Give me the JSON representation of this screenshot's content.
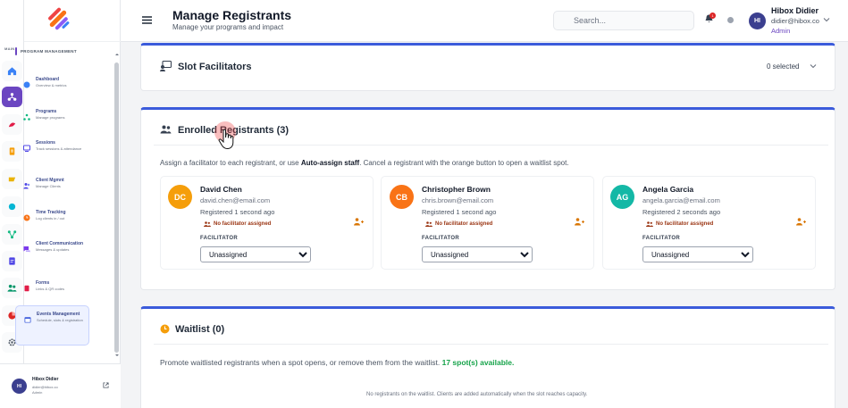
{
  "rail": {
    "section_label": "MAIN",
    "icons": [
      "home-icon",
      "programs-icon",
      "sessions-icon",
      "clipboard-icon",
      "coins-icon",
      "circle-icon",
      "network-icon",
      "document-icon",
      "users-icon",
      "chart-icon",
      "settings-icon"
    ]
  },
  "nav": {
    "section_label": "PROGRAM MANAGEMENT",
    "items": [
      {
        "title": "Dashboard",
        "desc": "Overview & metrics"
      },
      {
        "title": "Programs",
        "desc": "Manage programs"
      },
      {
        "title": "Sessions",
        "desc": "Track sessions & attendance"
      },
      {
        "title": "Client Mgmnt",
        "desc": "Manage Clients"
      },
      {
        "title": "Time Tracking",
        "desc": "Log clients in / out"
      },
      {
        "title": "Client Communication",
        "desc": "Messages & updates"
      },
      {
        "title": "Forms",
        "desc": "Links & QR codes"
      },
      {
        "title": "Events Management",
        "desc": "Schedule, slots & registration"
      }
    ],
    "user": {
      "initials": "HI",
      "name": "Hibox Didier",
      "email": "didier@hibox.co",
      "role": "Admin"
    }
  },
  "header": {
    "title": "Manage Registrants",
    "subtitle": "Manage your programs and impact",
    "search_placeholder": "Search...",
    "notification_count": "1",
    "user": {
      "initials": "HI",
      "name": "Hibox Didier",
      "email": "didier@hibox.co",
      "role": "Admin"
    }
  },
  "slot_facilitators": {
    "title": "Slot Facilitators",
    "selected": "0 selected"
  },
  "enrolled": {
    "title": "Enrolled Registrants (3)",
    "info_prefix": "Assign a facilitator to each registrant, or use ",
    "info_bold": "Auto-assign staff",
    "info_suffix": ". Cancel a registrant with the orange button to open a waitlist spot.",
    "facilitator_label": "FACILITATOR",
    "registrants": [
      {
        "initials": "DC",
        "color": "#f59e0b",
        "name": "David Chen",
        "email": "david.chen@email.com",
        "registered": "Registered 1 second ago",
        "status": "No facilitator assigned",
        "facilitator": "Unassigned"
      },
      {
        "initials": "CB",
        "color": "#f97316",
        "name": "Christopher Brown",
        "email": "chris.brown@email.com",
        "registered": "Registered 1 second ago",
        "status": "No facilitator assigned",
        "facilitator": "Unassigned"
      },
      {
        "initials": "AG",
        "color": "#14b8a6",
        "name": "Angela Garcia",
        "email": "angela.garcia@email.com",
        "registered": "Registered 2 seconds ago",
        "status": "No facilitator assigned",
        "facilitator": "Unassigned"
      }
    ]
  },
  "waitlist": {
    "title": "Waitlist (0)",
    "info_prefix": "Promote waitlisted registrants when a spot opens, or remove them from the waitlist. ",
    "info_highlight": "17 spot(s) available.",
    "empty_text": "No registrants on the waitlist. Clients are added automatically when the slot reaches capacity."
  },
  "colors": {
    "accent": "#6b46c1",
    "card_border": "#3b5bdb",
    "success": "#16a34a",
    "warning": "#9a3412"
  }
}
